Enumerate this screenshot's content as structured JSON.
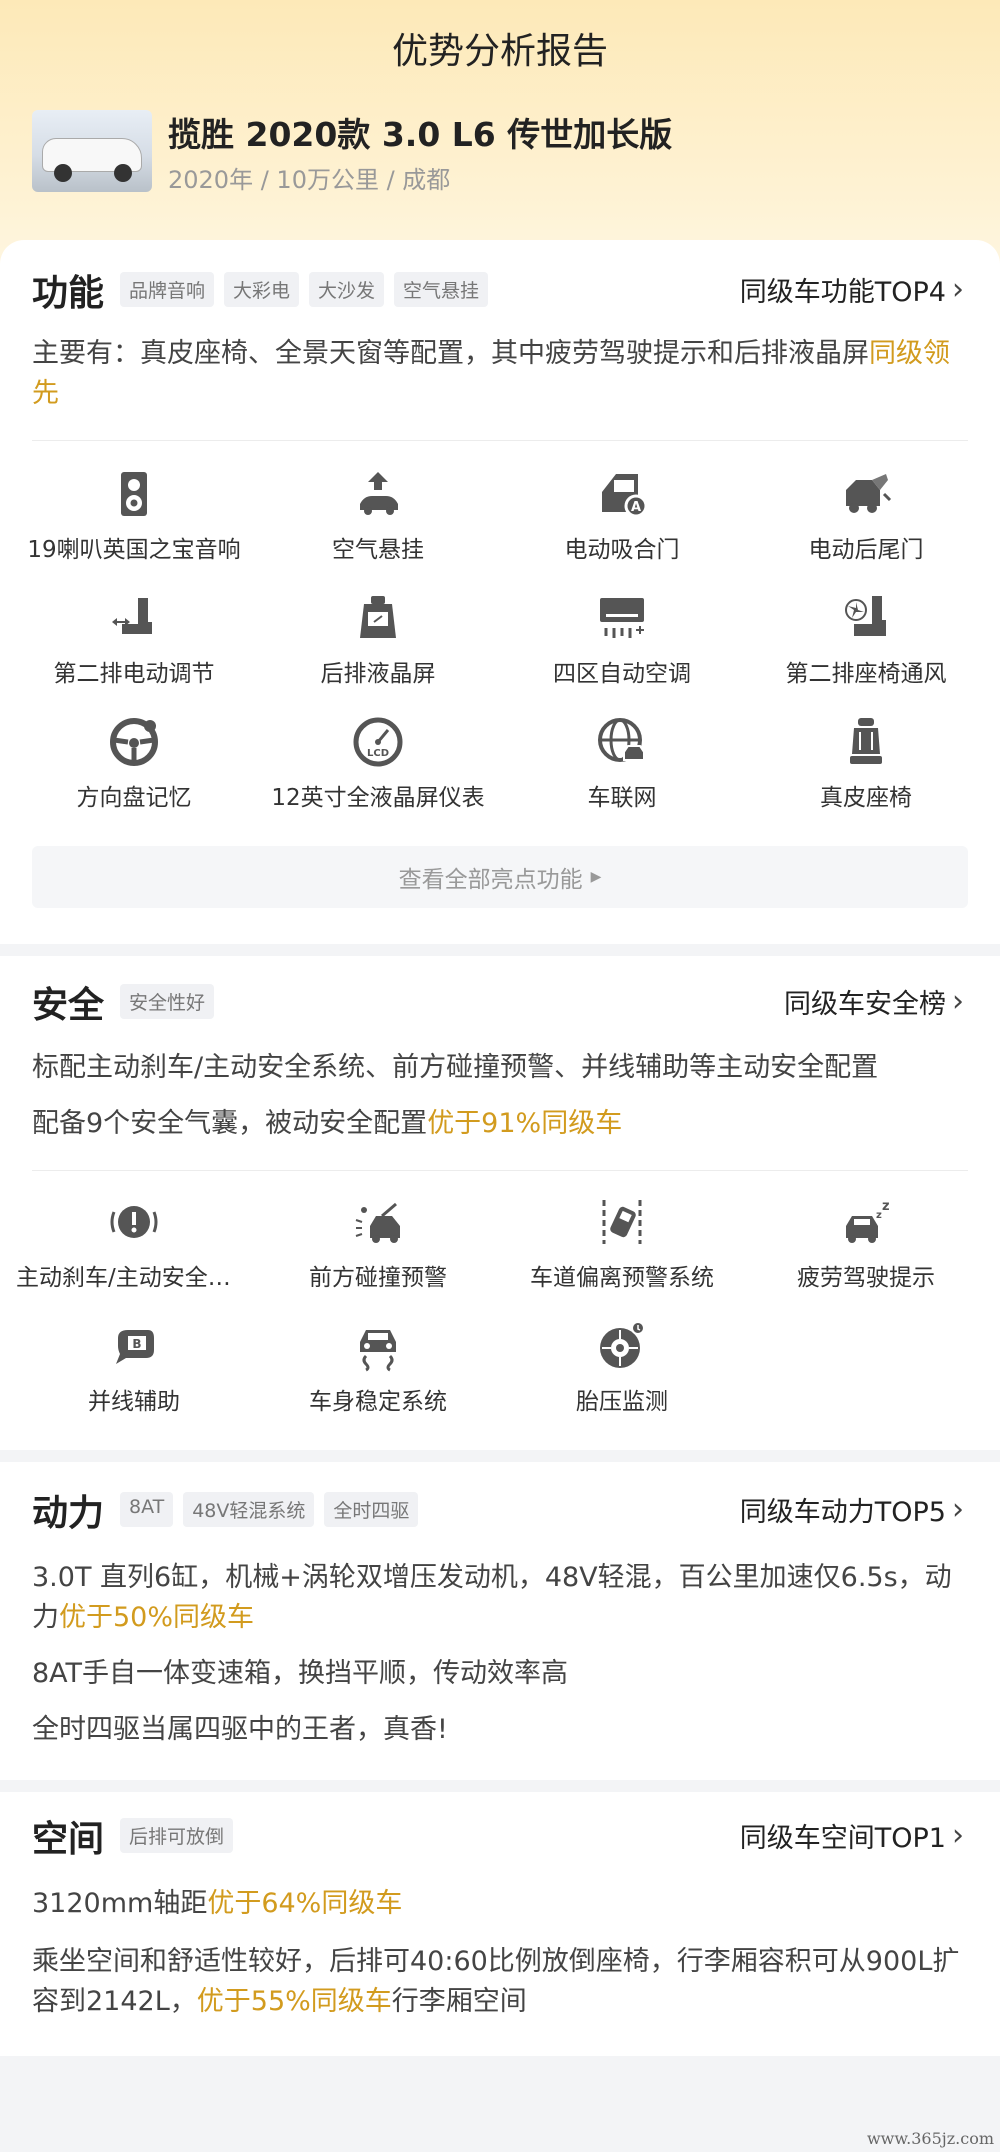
{
  "header": {
    "title": "优势分析报告",
    "car_name": "揽胜 2020款 3.0 L6 传世加长版",
    "car_meta": "2020年 / 10万公里 / 成都"
  },
  "function": {
    "title": "功能",
    "tags": [
      "品牌音响",
      "大彩电",
      "大沙发",
      "空气悬挂"
    ],
    "rank_link": "同级车功能TOP4",
    "desc_prefix": "主要有：真皮座椅、全景天窗等配置，其中疲劳驾驶提示和后排液晶屏",
    "desc_highlight": "同级领先",
    "items": [
      {
        "label": "19喇叭英国之宝音响",
        "icon": "speaker-icon"
      },
      {
        "label": "空气悬挂",
        "icon": "air-suspension-icon"
      },
      {
        "label": "电动吸合门",
        "icon": "power-door-icon"
      },
      {
        "label": "电动后尾门",
        "icon": "power-tailgate-icon"
      },
      {
        "label": "第二排电动调节",
        "icon": "seat-adjust-icon"
      },
      {
        "label": "后排液晶屏",
        "icon": "rear-screen-icon"
      },
      {
        "label": "四区自动空调",
        "icon": "air-conditioner-icon"
      },
      {
        "label": "第二排座椅通风",
        "icon": "seat-ventilation-icon"
      },
      {
        "label": "方向盘记忆",
        "icon": "steering-wheel-icon"
      },
      {
        "label": "12英寸全液晶屏仪表",
        "icon": "lcd-gauge-icon"
      },
      {
        "label": "车联网",
        "icon": "connected-car-icon"
      },
      {
        "label": "真皮座椅",
        "icon": "leather-seat-icon"
      }
    ],
    "see_all": "查看全部亮点功能"
  },
  "safety": {
    "title": "安全",
    "tags": [
      "安全性好"
    ],
    "rank_link": "同级车安全榜",
    "desc1": "标配主动刹车/主动安全系统、前方碰撞预警、并线辅助等主动安全配置",
    "desc2_prefix": "配备9个安全气囊，被动安全配置",
    "desc2_highlight": "优于91%同级车",
    "items": [
      {
        "label": "主动刹车/主动安全系统",
        "icon": "active-brake-icon"
      },
      {
        "label": "前方碰撞预警",
        "icon": "collision-warning-icon"
      },
      {
        "label": "车道偏离预警系统",
        "icon": "lane-departure-icon"
      },
      {
        "label": "疲劳驾驶提示",
        "icon": "fatigue-warning-icon"
      },
      {
        "label": "并线辅助",
        "icon": "blind-spot-icon"
      },
      {
        "label": "车身稳定系统",
        "icon": "stability-control-icon"
      },
      {
        "label": "胎压监测",
        "icon": "tire-pressure-icon"
      }
    ]
  },
  "power": {
    "title": "动力",
    "tags": [
      "8AT",
      "48V轻混系统",
      "全时四驱"
    ],
    "rank_link": "同级车动力TOP5",
    "desc1_prefix": "3.0T 直列6缸，机械+涡轮双增压发动机，48V轻混，百公里加速仅6.5s，动力",
    "desc1_highlight": "优于50%同级车",
    "desc2": "8AT手自一体变速箱，换挡平顺，传动效率高",
    "desc3": "全时四驱当属四驱中的王者，真香!"
  },
  "space": {
    "title": "空间",
    "tags": [
      "后排可放倒"
    ],
    "rank_link": "同级车空间TOP1",
    "desc1_prefix": "3120mm轴距",
    "desc1_highlight": "优于64%同级车",
    "desc2_prefix": "乘坐空间和舒适性较好，后排可40:60比例放倒座椅，行李厢容积可从900L扩容到2142L，",
    "desc2_highlight": "优于55%同级车",
    "desc2_suffix": "行李厢空间"
  },
  "watermark": "www.365jz.com",
  "colors": {
    "highlight": "#d29b1e",
    "header_bg": "#fde9b8",
    "icon": "#555555"
  }
}
